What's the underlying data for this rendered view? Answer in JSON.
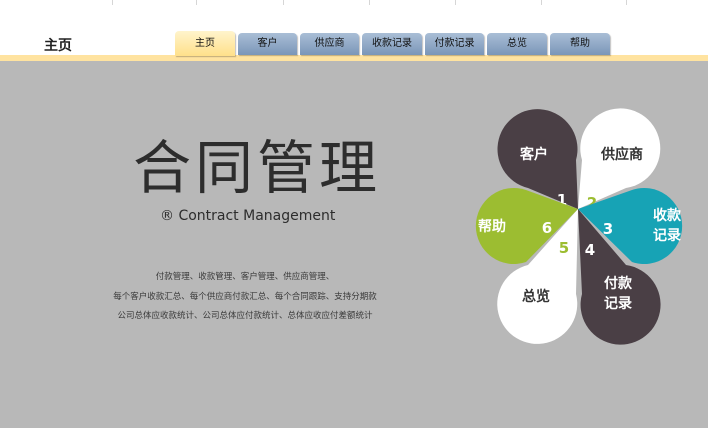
{
  "header": {
    "home_title": "主页",
    "tabs": [
      {
        "label": "主页",
        "active": true
      },
      {
        "label": "客户",
        "active": false
      },
      {
        "label": "供应商",
        "active": false
      },
      {
        "label": "收款记录",
        "active": false
      },
      {
        "label": "付款记录",
        "active": false
      },
      {
        "label": "总览",
        "active": false
      },
      {
        "label": "帮助",
        "active": false
      }
    ]
  },
  "main": {
    "title": "合同管理",
    "subtitle": "® Contract Management",
    "description": [
      "付款管理、收款管理、客户管理、供应商管理、",
      "每个客户收款汇总、每个供应商付款汇总、每个合同跟踪、支持分期款",
      "公司总体应收款统计、公司总体应付款统计、总体应收应付差额统计"
    ]
  },
  "flower": {
    "petals": [
      {
        "label": "客户",
        "number": "1",
        "color": "#4a3f45",
        "text_color": "#ffffff",
        "number_color": "#ffffff"
      },
      {
        "label": "供应商",
        "number": "2",
        "color": "#ffffff",
        "text_color": "#333333",
        "number_color": "#9cbd31"
      },
      {
        "label": "收款\n记录",
        "number": "3",
        "color": "#17a3b5",
        "text_color": "#ffffff",
        "number_color": "#ffffff"
      },
      {
        "label": "付款\n记录",
        "number": "4",
        "color": "#4a3f45",
        "text_color": "#ffffff",
        "number_color": "#ffffff"
      },
      {
        "label": "总览",
        "number": "5",
        "color": "#ffffff",
        "text_color": "#333333",
        "number_color": "#9cbd31"
      },
      {
        "label": "帮助",
        "number": "6",
        "color": "#9cbd31",
        "text_color": "#ffffff",
        "number_color": "#ffffff"
      }
    ]
  }
}
